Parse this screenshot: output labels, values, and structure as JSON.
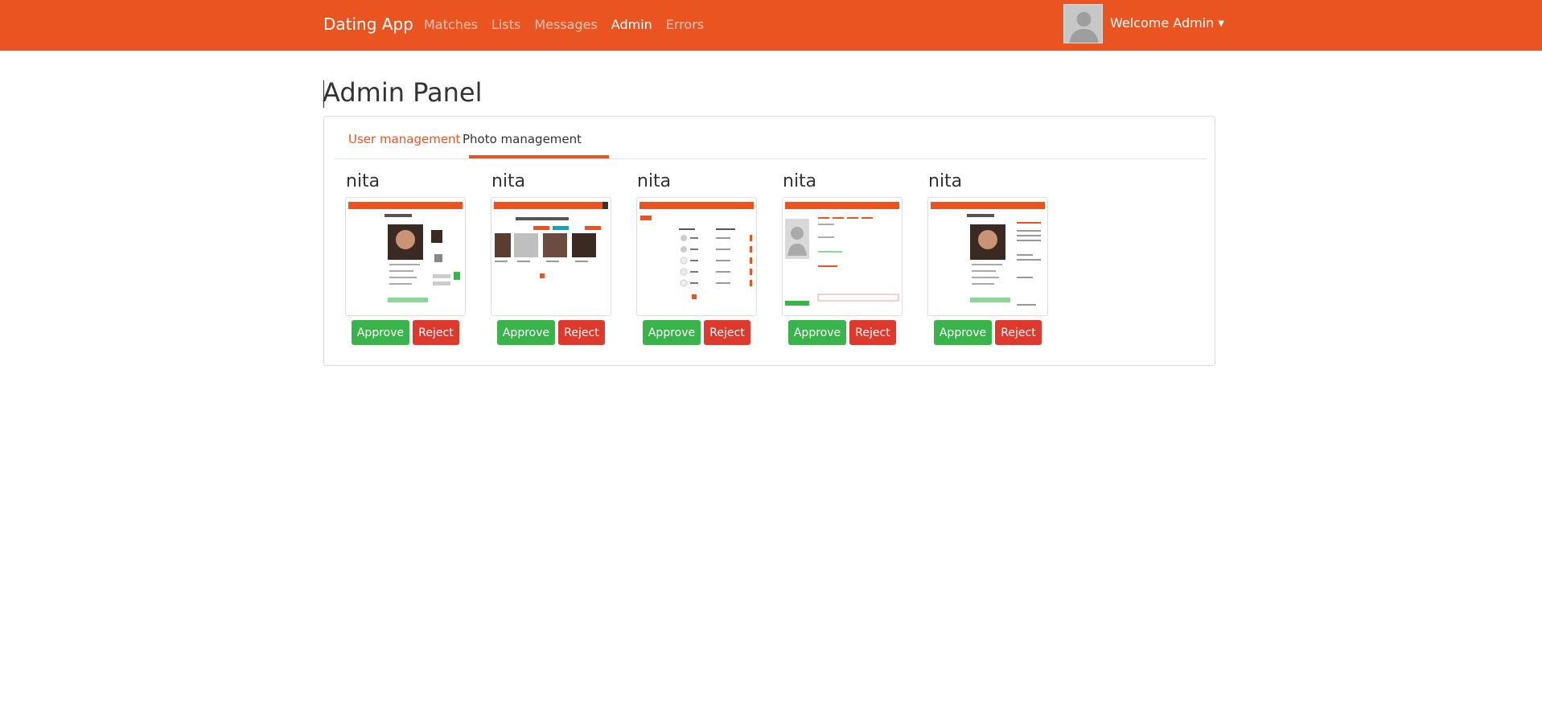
{
  "navbar": {
    "brand": "Dating App",
    "links": [
      "Matches",
      "Lists",
      "Messages",
      "Admin",
      "Errors"
    ],
    "welcome": "Welcome Admin",
    "color": "#e95420"
  },
  "page": {
    "title": "Admin Panel"
  },
  "tabs": [
    "User management",
    "Photo management"
  ],
  "photos": [
    {
      "owner": "nita",
      "approve": "Approve",
      "reject": "Reject",
      "thumb": "profile-page-screenshot"
    },
    {
      "owner": "nita",
      "approve": "Approve",
      "reject": "Reject",
      "thumb": "matches-page-screenshot"
    },
    {
      "owner": "nita",
      "approve": "Approve",
      "reject": "Reject",
      "thumb": "messages-page-screenshot"
    },
    {
      "owner": "nita",
      "approve": "Approve",
      "reject": "Reject",
      "thumb": "chat-page-screenshot"
    },
    {
      "owner": "nita",
      "approve": "Approve",
      "reject": "Reject",
      "thumb": "profile-page-screenshot"
    }
  ],
  "colors": {
    "approve": "#38b44a",
    "reject": "#df382c"
  }
}
